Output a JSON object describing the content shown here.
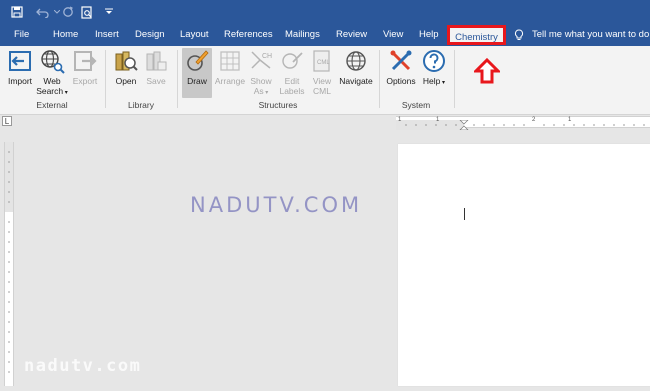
{
  "tabs": {
    "file": "File",
    "home": "Home",
    "insert": "Insert",
    "design": "Design",
    "layout": "Layout",
    "references": "References",
    "mailings": "Mailings",
    "review": "Review",
    "view": "View",
    "help": "Help",
    "chemistry": "Chemistry",
    "tell_me": "Tell me what you want to do"
  },
  "ribbon": {
    "external": {
      "group_label": "External",
      "import": "Import",
      "web_search_1": "Web",
      "web_search_2": "Search",
      "export": "Export"
    },
    "library": {
      "group_label": "Library",
      "open": "Open",
      "save": "Save"
    },
    "structures": {
      "group_label": "Structures",
      "draw": "Draw",
      "arrange": "Arrange",
      "show_as_1": "Show",
      "show_as_2": "As",
      "edit_labels_1": "Edit",
      "edit_labels_2": "Labels",
      "view_cml_1": "View",
      "view_cml_2": "CML",
      "navigate": "Navigate"
    },
    "system": {
      "group_label": "System",
      "options": "Options",
      "help": "Help"
    }
  },
  "ruler": {
    "corner": "L",
    "marks": [
      "1",
      "1",
      "2",
      "1"
    ]
  },
  "watermarks": {
    "center": "NADUTV.COM",
    "bottom": "nadutv.com"
  }
}
